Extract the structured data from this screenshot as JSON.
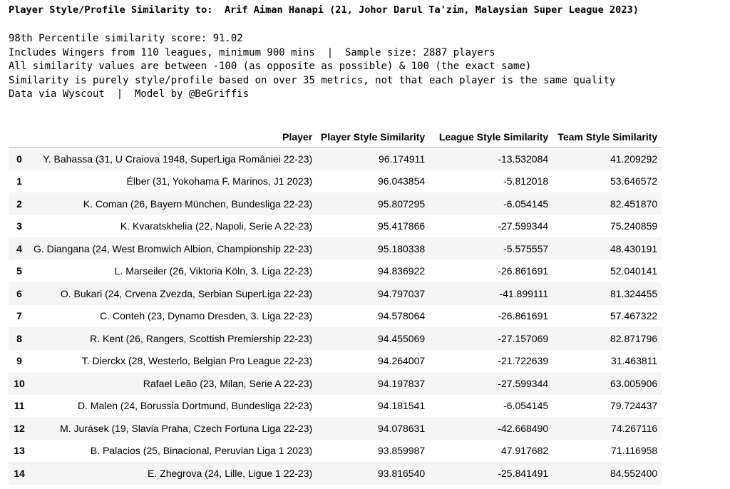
{
  "title": "Player Style/Profile Similarity to:  Arif Aiman Hanapi (21, Johor Darul Ta'zim, Malaysian Super League 2023)",
  "info_lines": [
    "98th Percentile similarity score: 91.02",
    "Includes Wingers from 110 leagues, minimum 900 mins  |  Sample size: 2887 players",
    "All similarity values are between -100 (as opposite as possible) & 100 (the exact same)",
    "Similarity is purely style/profile based on over 35 metrics, not that each player is the same quality",
    "Data via Wyscout  |  Model by @BeGriffis"
  ],
  "table": {
    "columns": [
      "",
      "Player",
      "Player Style Similarity",
      "League Style Similarity",
      "Team Style Similarity"
    ],
    "rows": [
      [
        "0",
        "Y. Bahassa (31, U Craiova 1948, SuperLiga României 22-23)",
        "96.174911",
        "-13.532084",
        "41.209292"
      ],
      [
        "1",
        "Élber (31, Yokohama F. Marinos, J1 2023)",
        "96.043854",
        "-5.812018",
        "53.646572"
      ],
      [
        "2",
        "K. Coman (26, Bayern München, Bundesliga 22-23)",
        "95.807295",
        "-6.054145",
        "82.451870"
      ],
      [
        "3",
        "K. Kvaratskhelia (22, Napoli, Serie A 22-23)",
        "95.417866",
        "-27.599344",
        "75.240859"
      ],
      [
        "4",
        "G. Diangana (24, West Bromwich Albion, Championship 22-23)",
        "95.180338",
        "-5.575557",
        "48.430191"
      ],
      [
        "5",
        "L. Marseiler (26, Viktoria Köln, 3. Liga 22-23)",
        "94.836922",
        "-26.861691",
        "52.040141"
      ],
      [
        "6",
        "O. Bukari (24, Crvena Zvezda, Serbian SuperLiga 22-23)",
        "94.797037",
        "-41.899111",
        "81.324455"
      ],
      [
        "7",
        "C. Conteh (23, Dynamo Dresden, 3. Liga 22-23)",
        "94.578064",
        "-26.861691",
        "57.467322"
      ],
      [
        "8",
        "R. Kent (26, Rangers, Scottish Premiership 22-23)",
        "94.455069",
        "-27.157069",
        "82.871796"
      ],
      [
        "9",
        "T. Dierckx (28, Westerlo, Belgian Pro League 22-23)",
        "94.264007",
        "-21.722639",
        "31.463811"
      ],
      [
        "10",
        "Rafael Leão (23, Milan, Serie A 22-23)",
        "94.197837",
        "-27.599344",
        "63.005906"
      ],
      [
        "11",
        "D. Malen (24, Borussia Dortmund, Bundesliga 22-23)",
        "94.181541",
        "-6.054145",
        "79.724437"
      ],
      [
        "12",
        "M. Jurásek (19, Slavia Praha, Czech Fortuna Liga 22-23)",
        "94.078631",
        "-42.668490",
        "74.267116"
      ],
      [
        "13",
        "B. Palacios (25, Binacional, Peruvian Liga 1 2023)",
        "93.859987",
        "47.917682",
        "71.116958"
      ],
      [
        "14",
        "E. Zhegrova (24, Lille, Ligue 1 22-23)",
        "93.816540",
        "-25.841491",
        "84.552400"
      ]
    ]
  }
}
